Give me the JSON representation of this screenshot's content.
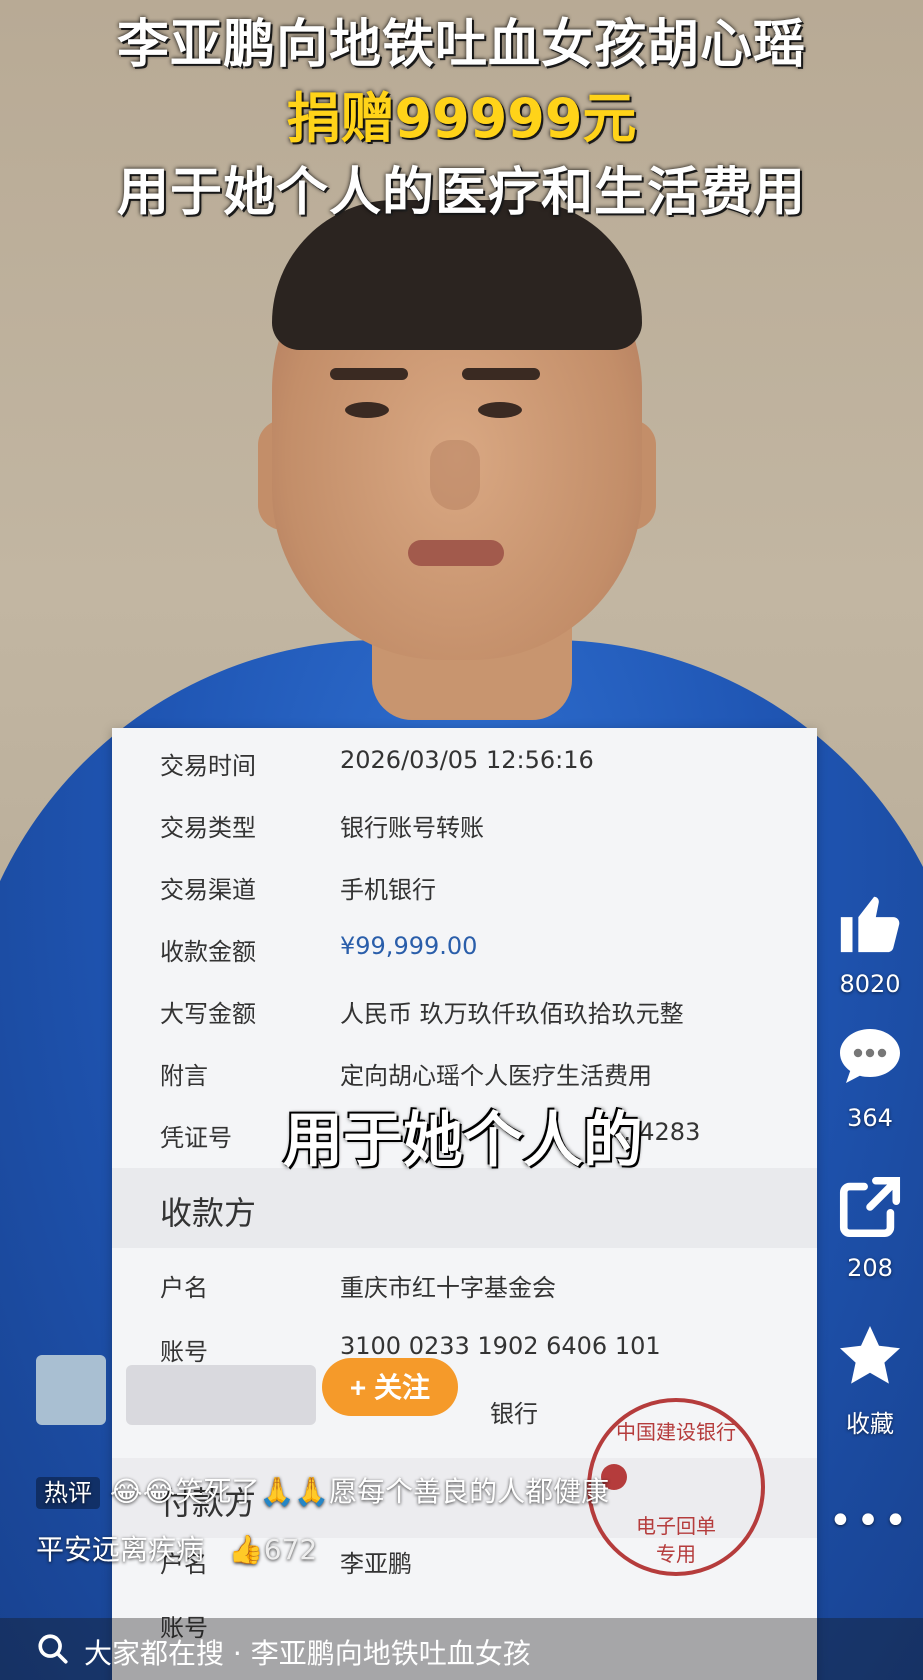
{
  "headline": {
    "line1": "李亚鹏向地铁吐血女孩胡心瑶",
    "line2": "捐赠99999元",
    "line3": "用于她个人的医疗和生活费用"
  },
  "receipt": {
    "rows": [
      {
        "label": "交易时间",
        "value": "2026/03/05 12:56:16"
      },
      {
        "label": "交易类型",
        "value": "银行账号转账"
      },
      {
        "label": "交易渠道",
        "value": "手机银行"
      },
      {
        "label": "收款金额",
        "value": "¥99,999.00"
      },
      {
        "label": "大写金额",
        "value": "人民币 玖万玖仟玖佰玖拾玖元整"
      },
      {
        "label": "附言",
        "value": "定向胡心瑶个人医疗生活费用"
      },
      {
        "label": "凭证号",
        "value": "6…4283"
      }
    ],
    "payee_section": "收款方",
    "payee_rows": [
      {
        "label": "户名",
        "value": "重庆市红十字基金会"
      },
      {
        "label": "账号",
        "value": "3100 0233 1902 6406 101"
      },
      {
        "label": "",
        "value": "银行"
      }
    ],
    "payer_section": "付款方",
    "payer_rows": [
      {
        "label": "户名",
        "value": "李亚鹏"
      },
      {
        "label": "账号",
        "value": ""
      }
    ],
    "seal": {
      "line1": "中国建设银行",
      "line2": "电子回单",
      "line3": "专用"
    }
  },
  "subtitle": "用于她个人的",
  "actions": {
    "like_count": "8020",
    "comment_count": "364",
    "share_count": "208",
    "favorite_label": "收藏"
  },
  "follow_button": "+ 关注",
  "comment": {
    "tag": "热评",
    "emoji": "😂😂",
    "text": "笑死了🙏🙏愿每个善良的人都健康",
    "line2": "平安远离疾病",
    "likes": "672"
  },
  "search": {
    "query": "大家都在搜 · 李亚鹏向地铁吐血女孩"
  }
}
